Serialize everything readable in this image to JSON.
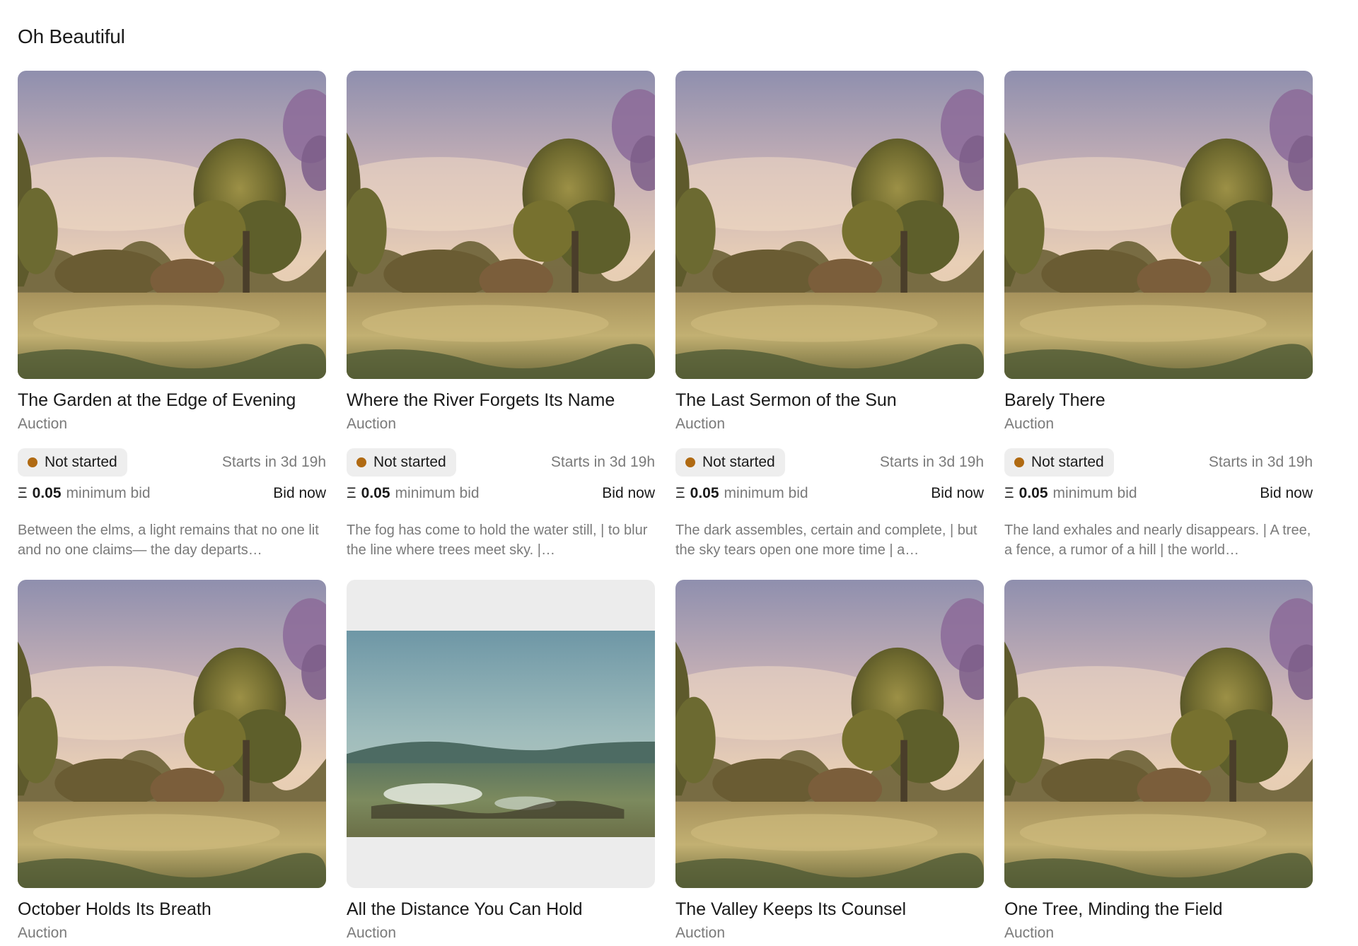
{
  "section": {
    "title": "Oh Beautiful"
  },
  "colors": {
    "status_dot": "#b06a12",
    "muted_text": "#7a7a7a",
    "pill_bg": "#eeeeee"
  },
  "cards": [
    {
      "title": "The Garden at the Edge of Evening",
      "type": "Auction",
      "image": "landscape-painting-tree",
      "status": "Not started",
      "starts_in": "Starts in  3d 19h",
      "currency_icon": "Ξ",
      "min_bid": "0.05",
      "min_bid_caption": "minimum bid",
      "action": "Bid now",
      "description": "Between the elms, a light remains that no one lit and no one claims— the day departs…"
    },
    {
      "title": "Where the River Forgets Its Name",
      "type": "Auction",
      "image": "landscape-painting-tree",
      "status": "Not started",
      "starts_in": "Starts in  3d 19h",
      "currency_icon": "Ξ",
      "min_bid": "0.05",
      "min_bid_caption": "minimum bid",
      "action": "Bid now",
      "description": "The fog has come to hold the water still, | to blur the line where trees meet sky. |…"
    },
    {
      "title": "The Last Sermon of the Sun",
      "type": "Auction",
      "image": "landscape-painting-tree",
      "status": "Not started",
      "starts_in": "Starts in  3d 19h",
      "currency_icon": "Ξ",
      "min_bid": "0.05",
      "min_bid_caption": "minimum bid",
      "action": "Bid now",
      "description": "The dark assembles, certain and complete, | but the sky tears open one more time | a…"
    },
    {
      "title": "Barely There",
      "type": "Auction",
      "image": "landscape-painting-tree",
      "status": "Not started",
      "starts_in": "Starts in  3d 19h",
      "currency_icon": "Ξ",
      "min_bid": "0.05",
      "min_bid_caption": "minimum bid",
      "action": "Bid now",
      "description": "The land exhales and nearly disappears. | A tree, a fence, a rumor of a hill | the world…"
    },
    {
      "title": "October Holds Its Breath",
      "type": "Auction",
      "image": "landscape-painting-tree"
    },
    {
      "title": "All the Distance You Can Hold",
      "type": "Auction",
      "image": "marsh-painting-wide"
    },
    {
      "title": "The Valley Keeps Its Counsel",
      "type": "Auction",
      "image": "landscape-painting-tree"
    },
    {
      "title": "One Tree, Minding the Field",
      "type": "Auction",
      "image": "landscape-painting-tree"
    }
  ]
}
